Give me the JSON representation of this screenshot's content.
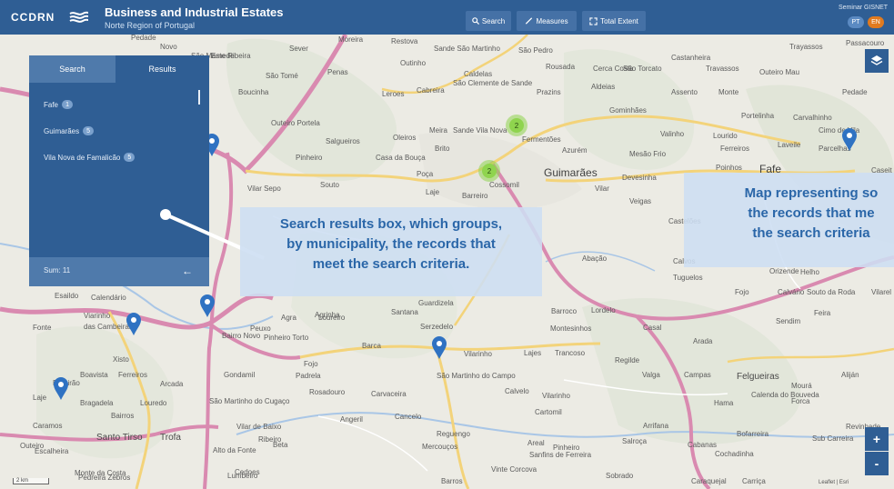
{
  "header": {
    "logo_text": "CCDRN",
    "title": "Business and Industrial Estates",
    "subtitle": "Norte Region of Portugal",
    "buttons": [
      {
        "icon": "search-icon",
        "label": "Search"
      },
      {
        "icon": "ruler-icon",
        "label": "Measures"
      },
      {
        "icon": "expand-icon",
        "label": "Total Extent"
      }
    ],
    "user": "Seminar GISNET",
    "languages": [
      {
        "code": "PT",
        "color": "#5b8ac2"
      },
      {
        "code": "EN",
        "color": "#e07a1f"
      }
    ]
  },
  "search_panel": {
    "tabs": {
      "search": "Search",
      "results": "Results"
    },
    "results": [
      {
        "municipality": "Fafe",
        "count": "1"
      },
      {
        "municipality": "Guimarães",
        "count": "5"
      },
      {
        "municipality": "Vila Nova de Famalicão",
        "count": "5"
      }
    ],
    "sum_label": "Sum: 11",
    "back_icon": "arrow-left-icon"
  },
  "callouts": {
    "results_box": [
      "Search results box, which groups,",
      "by municipality, the records that",
      "meet the search criteria."
    ],
    "map": [
      "Map representing so",
      "the records that me",
      "the search criteria"
    ]
  },
  "map": {
    "clusters": [
      {
        "label": "2"
      },
      {
        "label": "2"
      }
    ],
    "places": [
      {
        "name": "Pedade",
        "cls": ""
      },
      {
        "name": "Novo",
        "cls": ""
      },
      {
        "name": "São Mamede",
        "cls": ""
      },
      {
        "name": "Este Ribeira",
        "cls": ""
      },
      {
        "name": "Sever",
        "cls": ""
      },
      {
        "name": "Moreira",
        "cls": ""
      },
      {
        "name": "Restova",
        "cls": ""
      },
      {
        "name": "Sande São Martinho",
        "cls": ""
      },
      {
        "name": "São Pedro",
        "cls": ""
      },
      {
        "name": "Castanheira",
        "cls": ""
      },
      {
        "name": "Trayassos",
        "cls": ""
      },
      {
        "name": "Passacouro",
        "cls": ""
      },
      {
        "name": "São Tomé",
        "cls": ""
      },
      {
        "name": "Penas",
        "cls": ""
      },
      {
        "name": "Outinho",
        "cls": ""
      },
      {
        "name": "Caldelas",
        "cls": ""
      },
      {
        "name": "Rousada",
        "cls": ""
      },
      {
        "name": "Cerca Costa",
        "cls": ""
      },
      {
        "name": "São Torcato",
        "cls": ""
      },
      {
        "name": "Travassos",
        "cls": ""
      },
      {
        "name": "Outeiro Mau",
        "cls": ""
      },
      {
        "name": "Pedade",
        "cls": ""
      },
      {
        "name": "Boucinha",
        "cls": ""
      },
      {
        "name": "Leroes",
        "cls": ""
      },
      {
        "name": "Cabreira",
        "cls": ""
      },
      {
        "name": "São Clemente de Sande",
        "cls": ""
      },
      {
        "name": "Prazins",
        "cls": ""
      },
      {
        "name": "Aldeias",
        "cls": ""
      },
      {
        "name": "Assento",
        "cls": ""
      },
      {
        "name": "Monte",
        "cls": ""
      },
      {
        "name": "Gominhães",
        "cls": ""
      },
      {
        "name": "Portelinha",
        "cls": ""
      },
      {
        "name": "Carvalhinho",
        "cls": ""
      },
      {
        "name": "Outeiro Portela",
        "cls": ""
      },
      {
        "name": "Salgueiros",
        "cls": ""
      },
      {
        "name": "Oleiros",
        "cls": ""
      },
      {
        "name": "Meira",
        "cls": ""
      },
      {
        "name": "Sande Vila Nova",
        "cls": ""
      },
      {
        "name": "Fermentões",
        "cls": ""
      },
      {
        "name": "Azurém",
        "cls": ""
      },
      {
        "name": "Valinho",
        "cls": ""
      },
      {
        "name": "Lourido",
        "cls": ""
      },
      {
        "name": "Cimo de Vila",
        "cls": ""
      },
      {
        "name": "Ferreiros",
        "cls": ""
      },
      {
        "name": "Laveile",
        "cls": ""
      },
      {
        "name": "Parcelhas",
        "cls": ""
      },
      {
        "name": "Caseit",
        "cls": ""
      },
      {
        "name": "Pinheiro",
        "cls": ""
      },
      {
        "name": "Casa da Bouça",
        "cls": ""
      },
      {
        "name": "Brito",
        "cls": ""
      },
      {
        "name": "Guimarães",
        "cls": "big"
      },
      {
        "name": "Mesão Frio",
        "cls": ""
      },
      {
        "name": "Poinhos",
        "cls": ""
      },
      {
        "name": "Fafe",
        "cls": "big"
      },
      {
        "name": "Vilar Sepo",
        "cls": ""
      },
      {
        "name": "Souto",
        "cls": ""
      },
      {
        "name": "Poça",
        "cls": ""
      },
      {
        "name": "Devesinha",
        "cls": ""
      },
      {
        "name": "Cossomil",
        "cls": ""
      },
      {
        "name": "Vilar",
        "cls": ""
      },
      {
        "name": "Laje",
        "cls": ""
      },
      {
        "name": "Barreiro",
        "cls": ""
      },
      {
        "name": "Veigas",
        "cls": ""
      },
      {
        "name": "Castelões",
        "cls": ""
      },
      {
        "name": "Abação",
        "cls": ""
      },
      {
        "name": "Calvos",
        "cls": ""
      },
      {
        "name": "Orizende",
        "cls": ""
      },
      {
        "name": "Helho",
        "cls": ""
      },
      {
        "name": "Tuguelos",
        "cls": ""
      },
      {
        "name": "Fojo",
        "cls": ""
      },
      {
        "name": "Calvário",
        "cls": ""
      },
      {
        "name": "Souto da Roda",
        "cls": ""
      },
      {
        "name": "Vilarel",
        "cls": ""
      },
      {
        "name": "Esaildo",
        "cls": ""
      },
      {
        "name": "Calendário",
        "cls": ""
      },
      {
        "name": "Guardizela",
        "cls": ""
      },
      {
        "name": "Lordelo",
        "cls": ""
      },
      {
        "name": "Barroco",
        "cls": ""
      },
      {
        "name": "Fonte",
        "cls": ""
      },
      {
        "name": "Viarinho",
        "cls": ""
      },
      {
        "name": "das Cambeiras",
        "cls": ""
      },
      {
        "name": "Peuxo",
        "cls": ""
      },
      {
        "name": "Agra",
        "cls": ""
      },
      {
        "name": "Loureiro",
        "cls": ""
      },
      {
        "name": "Agrinha",
        "cls": ""
      },
      {
        "name": "Santana",
        "cls": ""
      },
      {
        "name": "Serzedelo",
        "cls": ""
      },
      {
        "name": "Montesinhos",
        "cls": ""
      },
      {
        "name": "Casal",
        "cls": ""
      },
      {
        "name": "Feira",
        "cls": ""
      },
      {
        "name": "Bairro Novo",
        "cls": ""
      },
      {
        "name": "Pinheiro Torto",
        "cls": ""
      },
      {
        "name": "Barca",
        "cls": ""
      },
      {
        "name": "Vilarinho",
        "cls": ""
      },
      {
        "name": "Lajes",
        "cls": ""
      },
      {
        "name": "Trancoso",
        "cls": ""
      },
      {
        "name": "Arada",
        "cls": ""
      },
      {
        "name": "Sendim",
        "cls": ""
      },
      {
        "name": "Xisto",
        "cls": ""
      },
      {
        "name": "Fojo",
        "cls": ""
      },
      {
        "name": "Regilde",
        "cls": ""
      },
      {
        "name": "Boavista",
        "cls": ""
      },
      {
        "name": "Ferreiros",
        "cls": ""
      },
      {
        "name": "Ribeirão",
        "cls": ""
      },
      {
        "name": "Arcada",
        "cls": ""
      },
      {
        "name": "Gondamil",
        "cls": ""
      },
      {
        "name": "Padrela",
        "cls": ""
      },
      {
        "name": "São Martinho do Campo",
        "cls": ""
      },
      {
        "name": "Felgueiras",
        "cls": "mid"
      },
      {
        "name": "Valga",
        "cls": ""
      },
      {
        "name": "Campas",
        "cls": ""
      },
      {
        "name": "Aliján",
        "cls": ""
      },
      {
        "name": "Laje",
        "cls": ""
      },
      {
        "name": "Bragadela",
        "cls": ""
      },
      {
        "name": "Louredo",
        "cls": ""
      },
      {
        "name": "Rosadouro",
        "cls": ""
      },
      {
        "name": "Carvaceira",
        "cls": ""
      },
      {
        "name": "Calvelo",
        "cls": ""
      },
      {
        "name": "Vilarinho",
        "cls": ""
      },
      {
        "name": "Calenda do Bouveda",
        "cls": ""
      },
      {
        "name": "Mourá",
        "cls": ""
      },
      {
        "name": "Hama",
        "cls": ""
      },
      {
        "name": "Forca",
        "cls": ""
      },
      {
        "name": "Caramos",
        "cls": ""
      },
      {
        "name": "Bairros",
        "cls": ""
      },
      {
        "name": "São Martinho do Cugaço",
        "cls": ""
      },
      {
        "name": "Angeril",
        "cls": ""
      },
      {
        "name": "Cancelo",
        "cls": ""
      },
      {
        "name": "Cartomil",
        "cls": ""
      },
      {
        "name": "Revinhade",
        "cls": ""
      },
      {
        "name": "Vilar de Baixo",
        "cls": ""
      },
      {
        "name": "Santo Tirso",
        "cls": "mid"
      },
      {
        "name": "Trofa",
        "cls": "mid"
      },
      {
        "name": "Ribeiro",
        "cls": ""
      },
      {
        "name": "Reguengo",
        "cls": ""
      },
      {
        "name": "Areal",
        "cls": ""
      },
      {
        "name": "Salroça",
        "cls": ""
      },
      {
        "name": "Arrifana",
        "cls": ""
      },
      {
        "name": "Bofarreira",
        "cls": ""
      },
      {
        "name": "Sub Carreira",
        "cls": ""
      },
      {
        "name": "Outeiro",
        "cls": ""
      },
      {
        "name": "Escalheira",
        "cls": ""
      },
      {
        "name": "Alto da Fonte",
        "cls": ""
      },
      {
        "name": "Beta",
        "cls": ""
      },
      {
        "name": "Cabanas",
        "cls": ""
      },
      {
        "name": "Monte da Costa",
        "cls": ""
      },
      {
        "name": "Cedoes",
        "cls": ""
      },
      {
        "name": "Mercouços",
        "cls": ""
      },
      {
        "name": "Sanfins de Ferreira",
        "cls": ""
      },
      {
        "name": "Pinheiro",
        "cls": ""
      },
      {
        "name": "Cochadinha",
        "cls": ""
      },
      {
        "name": "Pedreira Zebros",
        "cls": ""
      },
      {
        "name": "Lumbeiro",
        "cls": ""
      },
      {
        "name": "Vinte Corcova",
        "cls": ""
      },
      {
        "name": "Barros",
        "cls": ""
      },
      {
        "name": "Sobrado",
        "cls": ""
      },
      {
        "name": "Caraquejal",
        "cls": ""
      },
      {
        "name": "Carriça",
        "cls": ""
      },
      {
        "name": "Airães",
        "cls": ""
      }
    ],
    "scale_label": "2 km",
    "attribution": "Leaflet | Esri"
  },
  "controls": {
    "layers_icon": "layers-icon",
    "zoom_in": "+",
    "zoom_out": "-"
  },
  "colors": {
    "header": "#2f5e94",
    "panel": "#2f5e94",
    "panel_tab": "#4f7aab",
    "marker": "#2f72c2",
    "cluster": "#8fd44e",
    "road_major": "#d98ab0",
    "road_minor": "#f3d37a",
    "callout_text": "#2a66a8"
  }
}
